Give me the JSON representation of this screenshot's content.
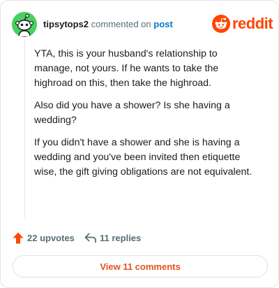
{
  "comment": {
    "username": "tipsytops2",
    "verb": "commented on",
    "target_link": "post",
    "avatar_icon": "snoo-avatar-icon",
    "avatar_color": "#46d160",
    "paragraphs": [
      "YTA, this is your husband's relationship to manage, not yours. If he wants to take the highroad on this, then take the highroad.",
      "Also did you have a shower? Is she having a wedding?",
      "If you didn't have a shower and she is having a wedding and you've been invited then etiquette wise, the gift giving obligations are not equivalent."
    ]
  },
  "brand": {
    "name": "reddit",
    "icon": "reddit-logo-icon",
    "color": "#ff4500"
  },
  "actions": {
    "upvotes_label": "22 upvotes",
    "upvote_icon": "upvote-arrow-icon",
    "upvote_color": "#ff4500",
    "replies_label": "11 replies",
    "reply_icon": "reply-arrow-icon"
  },
  "footer": {
    "view_comments_label": "View 11 comments"
  }
}
